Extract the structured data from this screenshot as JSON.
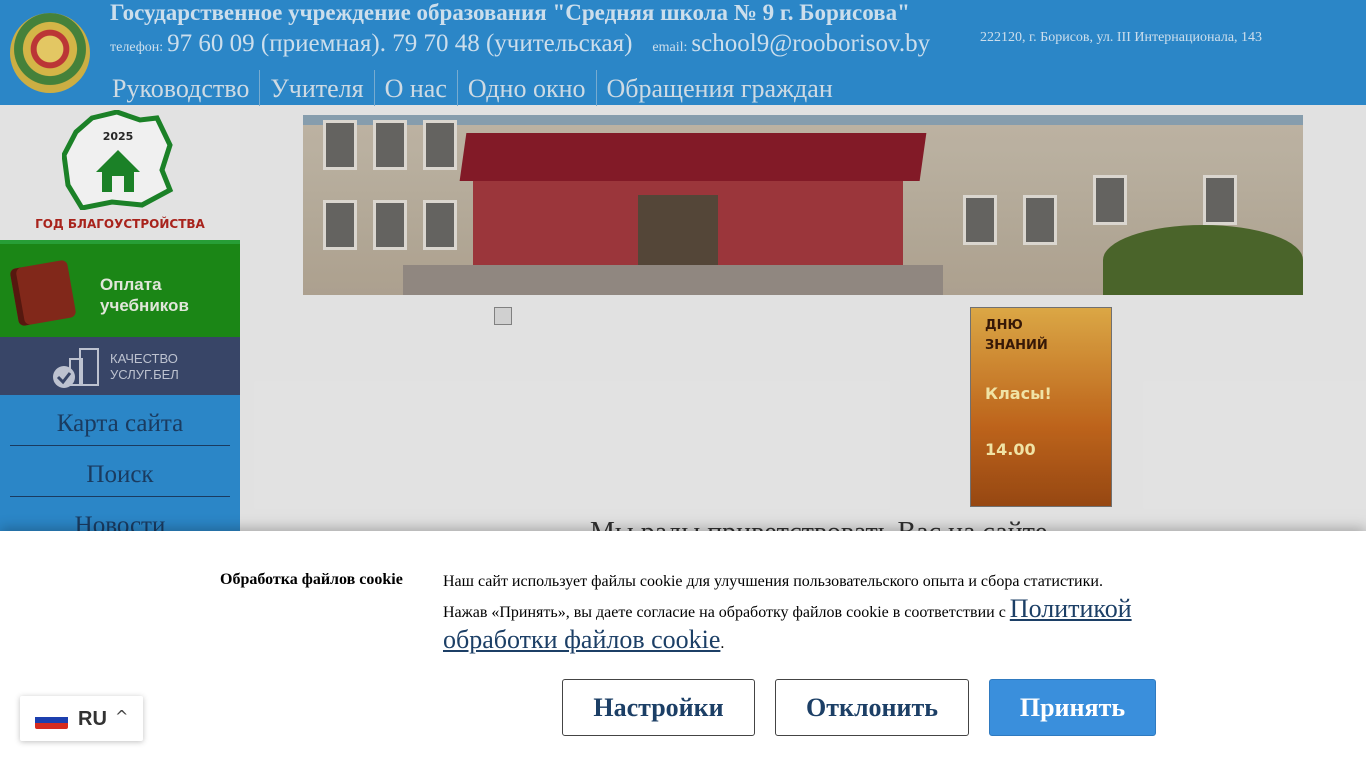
{
  "header": {
    "title": "Государственное учреждение образования \"Средняя школа № 9 г. Борисова\"",
    "phone_label": "телефон:",
    "phones": "97 60 09 (приемная). 79 70 48 (учительская)",
    "email_label": "email:",
    "email": "school9@rooborisov.by",
    "address": "222120, г. Борисов, ул. III Интернационала, 143"
  },
  "topnav": [
    "Руководство",
    "Учителя",
    "О нас",
    "Одно окно",
    "Обращения граждан"
  ],
  "sidebar": {
    "logo_year": "2025",
    "logo_caption": "ГОД БЛАГОУСТРОЙСТВА",
    "pay": {
      "line1": "Оплата",
      "line2": "учебников"
    },
    "quality": {
      "line1": "КАЧЕСТВО",
      "line2": "УСЛУГ.БЕЛ"
    },
    "links": [
      "Карта сайта",
      "Поиск",
      "Новости"
    ]
  },
  "poster": {
    "line1": "ДНЮ",
    "line2": "ЗНАНИЙ",
    "line3": "Класы!",
    "line4": "14.00"
  },
  "welcome": "Мы рады приветствовать Вас на сайте",
  "cookie": {
    "title": "Обработка файлов cookie",
    "text1": "Наш сайт использует файлы cookie для улучшения пользовательского опыта и сбора статистики.",
    "text2": "Нажав «Принять», вы даете согласие на обработку файлов cookie в соответствии с ",
    "link": "Политикой обработки файлов cookie",
    "period": ".",
    "settings": "Настройки",
    "decline": "Отклонить",
    "accept": "Принять"
  },
  "language": {
    "code": "RU",
    "icon": "chevron-up-icon"
  }
}
